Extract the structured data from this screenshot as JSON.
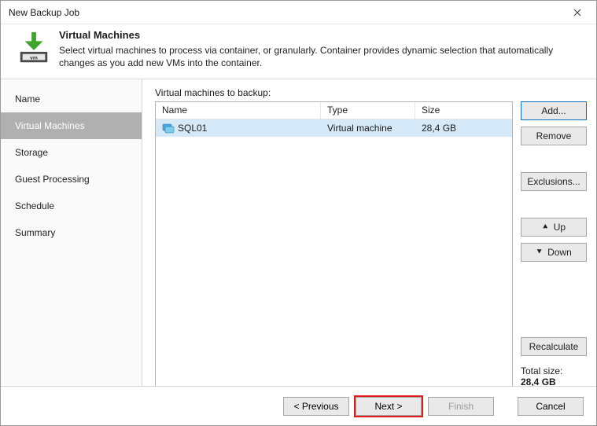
{
  "window": {
    "title": "New Backup Job"
  },
  "header": {
    "heading": "Virtual Machines",
    "description": "Select virtual machines to process via container, or granularly. Container provides dynamic selection that automatically changes as you add new VMs into the container."
  },
  "sidebar": {
    "steps": [
      {
        "label": "Name"
      },
      {
        "label": "Virtual Machines"
      },
      {
        "label": "Storage"
      },
      {
        "label": "Guest Processing"
      },
      {
        "label": "Schedule"
      },
      {
        "label": "Summary"
      }
    ],
    "active_index": 1
  },
  "list": {
    "label": "Virtual machines to backup:",
    "columns": {
      "name": "Name",
      "type": "Type",
      "size": "Size"
    },
    "rows": [
      {
        "name": "SQL01",
        "type": "Virtual machine",
        "size": "28,4 GB"
      }
    ]
  },
  "buttons": {
    "add": "Add...",
    "remove": "Remove",
    "exclusions": "Exclusions...",
    "up": "Up",
    "down": "Down",
    "recalculate": "Recalculate"
  },
  "totals": {
    "label": "Total size:",
    "value": "28,4 GB"
  },
  "footer": {
    "previous": "< Previous",
    "next": "Next >",
    "finish": "Finish",
    "cancel": "Cancel"
  }
}
